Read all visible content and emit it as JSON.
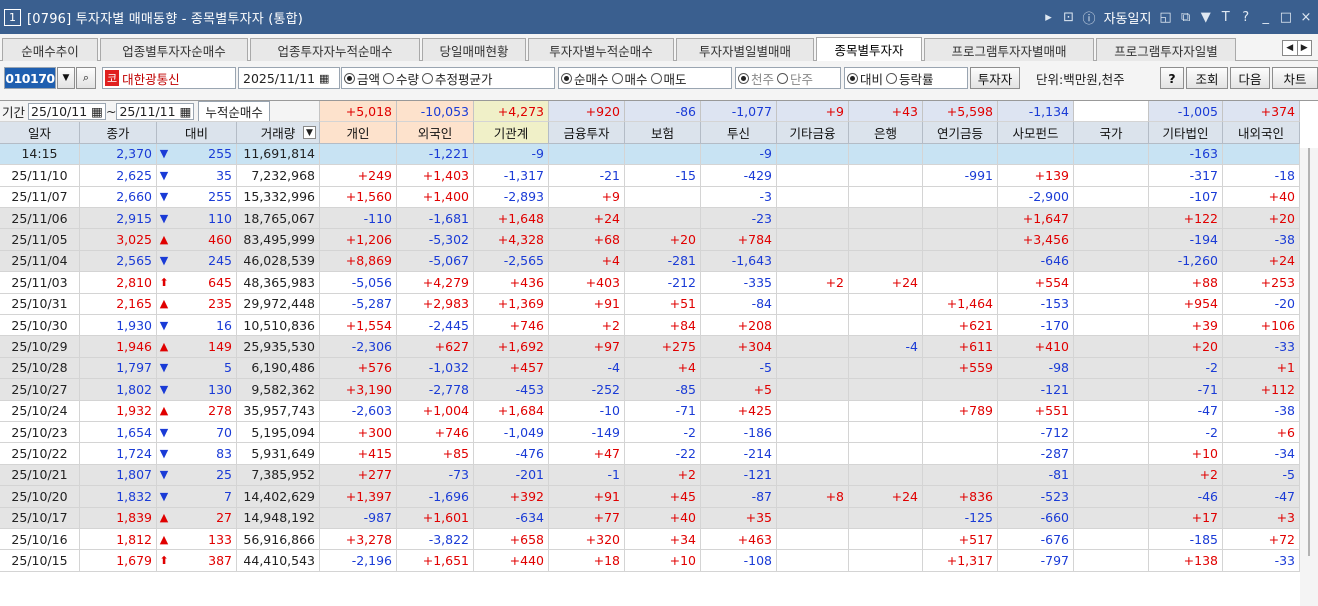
{
  "window": {
    "number": "1",
    "title": "[0796] 투자자별 매매동향 - 종목별투자자 (통합)",
    "right_text": "자동일지",
    "icons": [
      "play-icon",
      "screen-icon",
      "info-icon",
      "restore-icon",
      "copy-icon",
      "pin-icon",
      "font-icon",
      "help-icon",
      "minimize-icon",
      "maximize-icon",
      "close-icon"
    ],
    "glyphs": {
      "play": "▸",
      "screen": "⊡",
      "info": "ⓘ",
      "restore": "◱",
      "copy": "⧉",
      "pin": "▼",
      "font": "T",
      "help": "?",
      "minimize": "_",
      "maximize": "□",
      "close": "×"
    }
  },
  "tabs": [
    {
      "label": "순매수추이",
      "active": false
    },
    {
      "label": "업종별투자자순매수",
      "active": false
    },
    {
      "label": "업종투자자누적순매수",
      "active": false
    },
    {
      "label": "당일매매현황",
      "active": false
    },
    {
      "label": "투자자별누적순매수",
      "active": false
    },
    {
      "label": "투자자별일별매매",
      "active": false
    },
    {
      "label": "종목별투자자",
      "active": true
    },
    {
      "label": "프로그램투자자별매매",
      "active": false
    },
    {
      "label": "프로그램투자자일별",
      "active": false
    }
  ],
  "tab_scroll": {
    "left": "◀",
    "right": "▶"
  },
  "toolbar": {
    "stock_code": "010170",
    "search_icon": "🔍",
    "badge": "코",
    "stock_name": "대한광통신",
    "date": "2025/11/11",
    "amount_type": [
      {
        "label": "금액",
        "on": true
      },
      {
        "label": "수량",
        "on": false
      },
      {
        "label": "추정평균가",
        "on": false
      }
    ],
    "trade_type": [
      {
        "label": "순매수",
        "on": true
      },
      {
        "label": "매수",
        "on": false
      },
      {
        "label": "매도",
        "on": false
      }
    ],
    "unit_type": [
      {
        "label": "천주",
        "on": true
      },
      {
        "label": "단주",
        "on": false
      }
    ],
    "compare_type": [
      {
        "label": "대비",
        "on": true
      },
      {
        "label": "등락률",
        "on": false
      }
    ],
    "investor_btn": "투자자",
    "unit_label": "단위:백만원,천주",
    "help_btn": "?",
    "query_btn": "조회",
    "next_btn": "다음",
    "chart_btn": "차트"
  },
  "period": {
    "label": "기간",
    "from": "25/10/11",
    "sep": "~",
    "to": "25/11/11",
    "cum_label": "누적순매수"
  },
  "colors": {
    "positive": "#e00000",
    "negative": "#1a3bd6",
    "sum_pos_bg": "#fde2cc",
    "sum_neg_bg": "#dde4f2",
    "sum_mixed_bg": "#f0f0c8",
    "gray_row": "#e4e4e4",
    "blue_row": "#c8e3f3"
  },
  "columns": [
    "일자",
    "종가",
    "대비",
    "거래량",
    "개인",
    "외국인",
    "기관계",
    "금융투자",
    "보험",
    "투신",
    "기타금융",
    "은행",
    "연기금등",
    "사모펀드",
    "국가",
    "기타법인",
    "내외국인"
  ],
  "sums": [
    "+5,018",
    "-10,053",
    "+4,273",
    "+920",
    "-86",
    "-1,077",
    "+9",
    "+43",
    "+5,598",
    "-1,134",
    "",
    "-1,005",
    "+374"
  ],
  "rows": [
    {
      "style": "blue",
      "date": "14:15",
      "close": "2,370",
      "dir": "dn",
      "chg": "255",
      "vol": "11,691,814",
      "vals": [
        "",
        "-1,221",
        "-9",
        "",
        "",
        "-9",
        "",
        "",
        "",
        "",
        "",
        "-163",
        ""
      ]
    },
    {
      "style": "white",
      "date": "25/11/10",
      "close": "2,625",
      "dir": "dn",
      "chg": "35",
      "vol": "7,232,968",
      "vals": [
        "+249",
        "+1,403",
        "-1,317",
        "-21",
        "-15",
        "-429",
        "",
        "",
        "-991",
        "+139",
        "",
        "-317",
        "-18"
      ]
    },
    {
      "style": "white",
      "date": "25/11/07",
      "close": "2,660",
      "dir": "dn",
      "chg": "255",
      "vol": "15,332,996",
      "vals": [
        "+1,560",
        "+1,400",
        "-2,893",
        "+9",
        "",
        "-3",
        "",
        "",
        "",
        "-2,900",
        "",
        "-107",
        "+40"
      ]
    },
    {
      "style": "gray",
      "date": "25/11/06",
      "close": "2,915",
      "dir": "dn",
      "chg": "110",
      "vol": "18,765,067",
      "vals": [
        "-110",
        "-1,681",
        "+1,648",
        "+24",
        "",
        "-23",
        "",
        "",
        "",
        "+1,647",
        "",
        "+122",
        "+20"
      ]
    },
    {
      "style": "gray",
      "date": "25/11/05",
      "close": "3,025",
      "dir": "up",
      "chg": "460",
      "vol": "83,495,999",
      "vals": [
        "+1,206",
        "-5,302",
        "+4,328",
        "+68",
        "+20",
        "+784",
        "",
        "",
        "",
        "+3,456",
        "",
        "-194",
        "-38"
      ]
    },
    {
      "style": "gray",
      "date": "25/11/04",
      "close": "2,565",
      "dir": "dn",
      "chg": "245",
      "vol": "46,028,539",
      "vals": [
        "+8,869",
        "-5,067",
        "-2,565",
        "+4",
        "-281",
        "-1,643",
        "",
        "",
        "",
        "-646",
        "",
        "-1,260",
        "+24"
      ]
    },
    {
      "style": "white",
      "date": "25/11/03",
      "close": "2,810",
      "dir": "upbig",
      "chg": "645",
      "vol": "48,365,983",
      "vals": [
        "-5,056",
        "+4,279",
        "+436",
        "+403",
        "-212",
        "-335",
        "+2",
        "+24",
        "",
        "+554",
        "",
        "+88",
        "+253"
      ]
    },
    {
      "style": "white",
      "date": "25/10/31",
      "close": "2,165",
      "dir": "up",
      "chg": "235",
      "vol": "29,972,448",
      "vals": [
        "-5,287",
        "+2,983",
        "+1,369",
        "+91",
        "+51",
        "-84",
        "",
        "",
        "+1,464",
        "-153",
        "",
        "+954",
        "-20"
      ]
    },
    {
      "style": "white",
      "date": "25/10/30",
      "close": "1,930",
      "dir": "dn",
      "chg": "16",
      "vol": "10,510,836",
      "vals": [
        "+1,554",
        "-2,445",
        "+746",
        "+2",
        "+84",
        "+208",
        "",
        "",
        "+621",
        "-170",
        "",
        "+39",
        "+106"
      ]
    },
    {
      "style": "gray",
      "date": "25/10/29",
      "close": "1,946",
      "dir": "up",
      "chg": "149",
      "vol": "25,935,530",
      "vals": [
        "-2,306",
        "+627",
        "+1,692",
        "+97",
        "+275",
        "+304",
        "",
        "-4",
        "+611",
        "+410",
        "",
        "+20",
        "-33"
      ]
    },
    {
      "style": "gray",
      "date": "25/10/28",
      "close": "1,797",
      "dir": "dn",
      "chg": "5",
      "vol": "6,190,486",
      "vals": [
        "+576",
        "-1,032",
        "+457",
        "-4",
        "+4",
        "-5",
        "",
        "",
        "+559",
        "-98",
        "",
        "-2",
        "+1"
      ]
    },
    {
      "style": "gray",
      "date": "25/10/27",
      "close": "1,802",
      "dir": "dn",
      "chg": "130",
      "vol": "9,582,362",
      "vals": [
        "+3,190",
        "-2,778",
        "-453",
        "-252",
        "-85",
        "+5",
        "",
        "",
        "",
        "-121",
        "",
        "-71",
        "+112"
      ]
    },
    {
      "style": "white",
      "date": "25/10/24",
      "close": "1,932",
      "dir": "up",
      "chg": "278",
      "vol": "35,957,743",
      "vals": [
        "-2,603",
        "+1,004",
        "+1,684",
        "-10",
        "-71",
        "+425",
        "",
        "",
        "+789",
        "+551",
        "",
        "-47",
        "-38"
      ]
    },
    {
      "style": "white",
      "date": "25/10/23",
      "close": "1,654",
      "dir": "dn",
      "chg": "70",
      "vol": "5,195,094",
      "vals": [
        "+300",
        "+746",
        "-1,049",
        "-149",
        "-2",
        "-186",
        "",
        "",
        "",
        "-712",
        "",
        "-2",
        "+6"
      ]
    },
    {
      "style": "white",
      "date": "25/10/22",
      "close": "1,724",
      "dir": "dn",
      "chg": "83",
      "vol": "5,931,649",
      "vals": [
        "+415",
        "+85",
        "-476",
        "+47",
        "-22",
        "-214",
        "",
        "",
        "",
        "-287",
        "",
        "+10",
        "-34"
      ]
    },
    {
      "style": "gray",
      "date": "25/10/21",
      "close": "1,807",
      "dir": "dn",
      "chg": "25",
      "vol": "7,385,952",
      "vals": [
        "+277",
        "-73",
        "-201",
        "-1",
        "+2",
        "-121",
        "",
        "",
        "",
        "-81",
        "",
        "+2",
        "-5"
      ]
    },
    {
      "style": "gray",
      "date": "25/10/20",
      "close": "1,832",
      "dir": "dn",
      "chg": "7",
      "vol": "14,402,629",
      "vals": [
        "+1,397",
        "-1,696",
        "+392",
        "+91",
        "+45",
        "-87",
        "+8",
        "+24",
        "+836",
        "-523",
        "",
        "-46",
        "-47"
      ]
    },
    {
      "style": "gray",
      "date": "25/10/17",
      "close": "1,839",
      "dir": "up",
      "chg": "27",
      "vol": "14,948,192",
      "vals": [
        "-987",
        "+1,601",
        "-634",
        "+77",
        "+40",
        "+35",
        "",
        "",
        "-125",
        "-660",
        "",
        "+17",
        "+3"
      ]
    },
    {
      "style": "white",
      "date": "25/10/16",
      "close": "1,812",
      "dir": "up",
      "chg": "133",
      "vol": "56,916,866",
      "vals": [
        "+3,278",
        "-3,822",
        "+658",
        "+320",
        "+34",
        "+463",
        "",
        "",
        "+517",
        "-676",
        "",
        "-185",
        "+72"
      ]
    },
    {
      "style": "white",
      "date": "25/10/15",
      "close": "1,679",
      "dir": "upbig",
      "chg": "387",
      "vol": "44,410,543",
      "vals": [
        "-2,196",
        "+1,651",
        "+440",
        "+18",
        "+10",
        "-108",
        "",
        "",
        "+1,317",
        "-797",
        "",
        "+138",
        "-33"
      ]
    }
  ]
}
